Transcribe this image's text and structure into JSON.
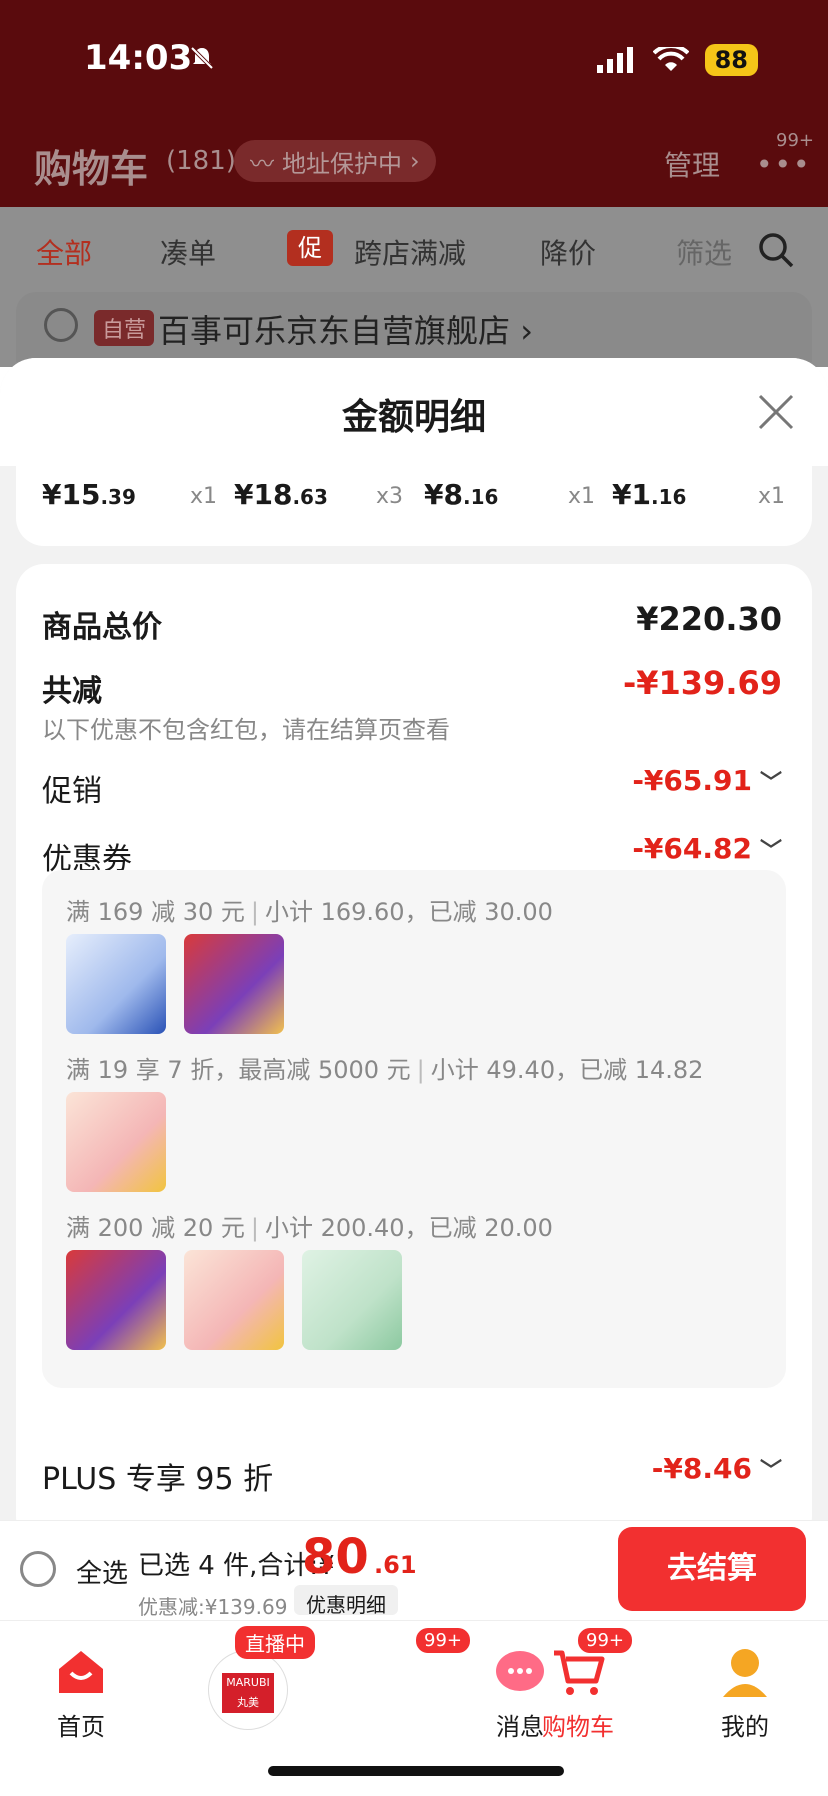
{
  "status_bar": {
    "time": "14:03",
    "battery": "88"
  },
  "cart_bg": {
    "title": "购物车",
    "count": "(181)",
    "address_pill": "地址保护中",
    "manage": "管理",
    "more_badge": "99+",
    "tabs": [
      "全部",
      "凑单",
      "跨店满减",
      "降价",
      "筛选"
    ],
    "promo_mark": "促",
    "store_tag": "自营",
    "store_name": "百事可乐京东自营旗舰店"
  },
  "sheet": {
    "title": "金额明细",
    "strip": [
      {
        "price_main": "¥15",
        "price_dec": ".39",
        "qty": "x1"
      },
      {
        "price_main": "¥18",
        "price_dec": ".63",
        "qty": "x3"
      },
      {
        "price_main": "¥8",
        "price_dec": ".16",
        "qty": "x1"
      },
      {
        "price_main": "¥1",
        "price_dec": ".16",
        "qty": "x1"
      }
    ],
    "goods_total_label": "商品总价",
    "goods_total_value": "¥220.30",
    "total_reduce_label": "共减",
    "total_reduce_value": "-¥139.69",
    "note": "以下优惠不包含红包，请在结算页查看",
    "promo_label": "促销",
    "promo_value": "-¥65.91",
    "coupon_label": "优惠券",
    "coupon_value": "-¥64.82",
    "coupon_rules": [
      {
        "rule": "满 169 减 30 元",
        "detail": "小计 169.60，已减 30.00"
      },
      {
        "rule": "满 19 享 7 折，最高减 5000 元",
        "detail": "小计 49.40，已减 14.82"
      },
      {
        "rule": "满 200 减 20 元",
        "detail": "小计 200.40，已减 20.00"
      }
    ],
    "plus_label": "PLUS 专享 95 折",
    "plus_value": "-¥8.46"
  },
  "footer": {
    "select_all": "全选",
    "selected": "已选 4 件,合计:¥",
    "total_main": "80",
    "total_dec": ".61",
    "discount": "优惠减:¥139.69",
    "detail_btn": "优惠明细",
    "checkout": "去结算"
  },
  "tabbar": {
    "items": [
      {
        "label": "首页"
      },
      {
        "label": "直播中"
      },
      {
        "label": "消息",
        "badge": "99+"
      },
      {
        "label": "购物车",
        "badge": "99+"
      },
      {
        "label": "我的"
      }
    ],
    "live_brand": "MARUBI 丸美"
  },
  "colors": {
    "accent": "#e2231a",
    "checkout": "#f23030"
  }
}
